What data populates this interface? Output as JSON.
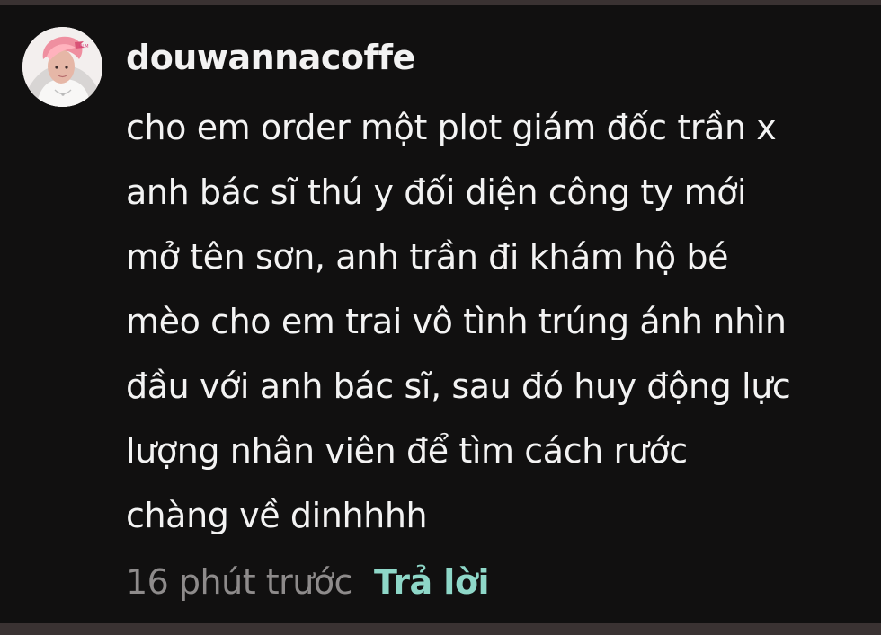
{
  "comment": {
    "username": "douwannacoffe",
    "avatar_icon": "user-profile-photo",
    "text_lines": [
      "cho em order một plot giám đốc trần x",
      "anh bác sĩ thú y đối diện công ty mới",
      "mở tên sơn, anh trần đi khám hộ bé",
      "mèo cho em trai vô tình trúng ánh nhìn",
      "đầu với anh bác sĩ, sau đó huy động lực",
      "lượng nhân viên để tìm cách rước",
      "chàng về dinhhhh"
    ],
    "timestamp": "16 phút trước",
    "reply_label": "Trả lời"
  },
  "colors": {
    "outer_background": "#3a3232",
    "card_background": "#111010",
    "primary_text": "#f3f3f3",
    "muted_text": "#8e8b8b",
    "reply_accent": "#8ed7c8"
  }
}
